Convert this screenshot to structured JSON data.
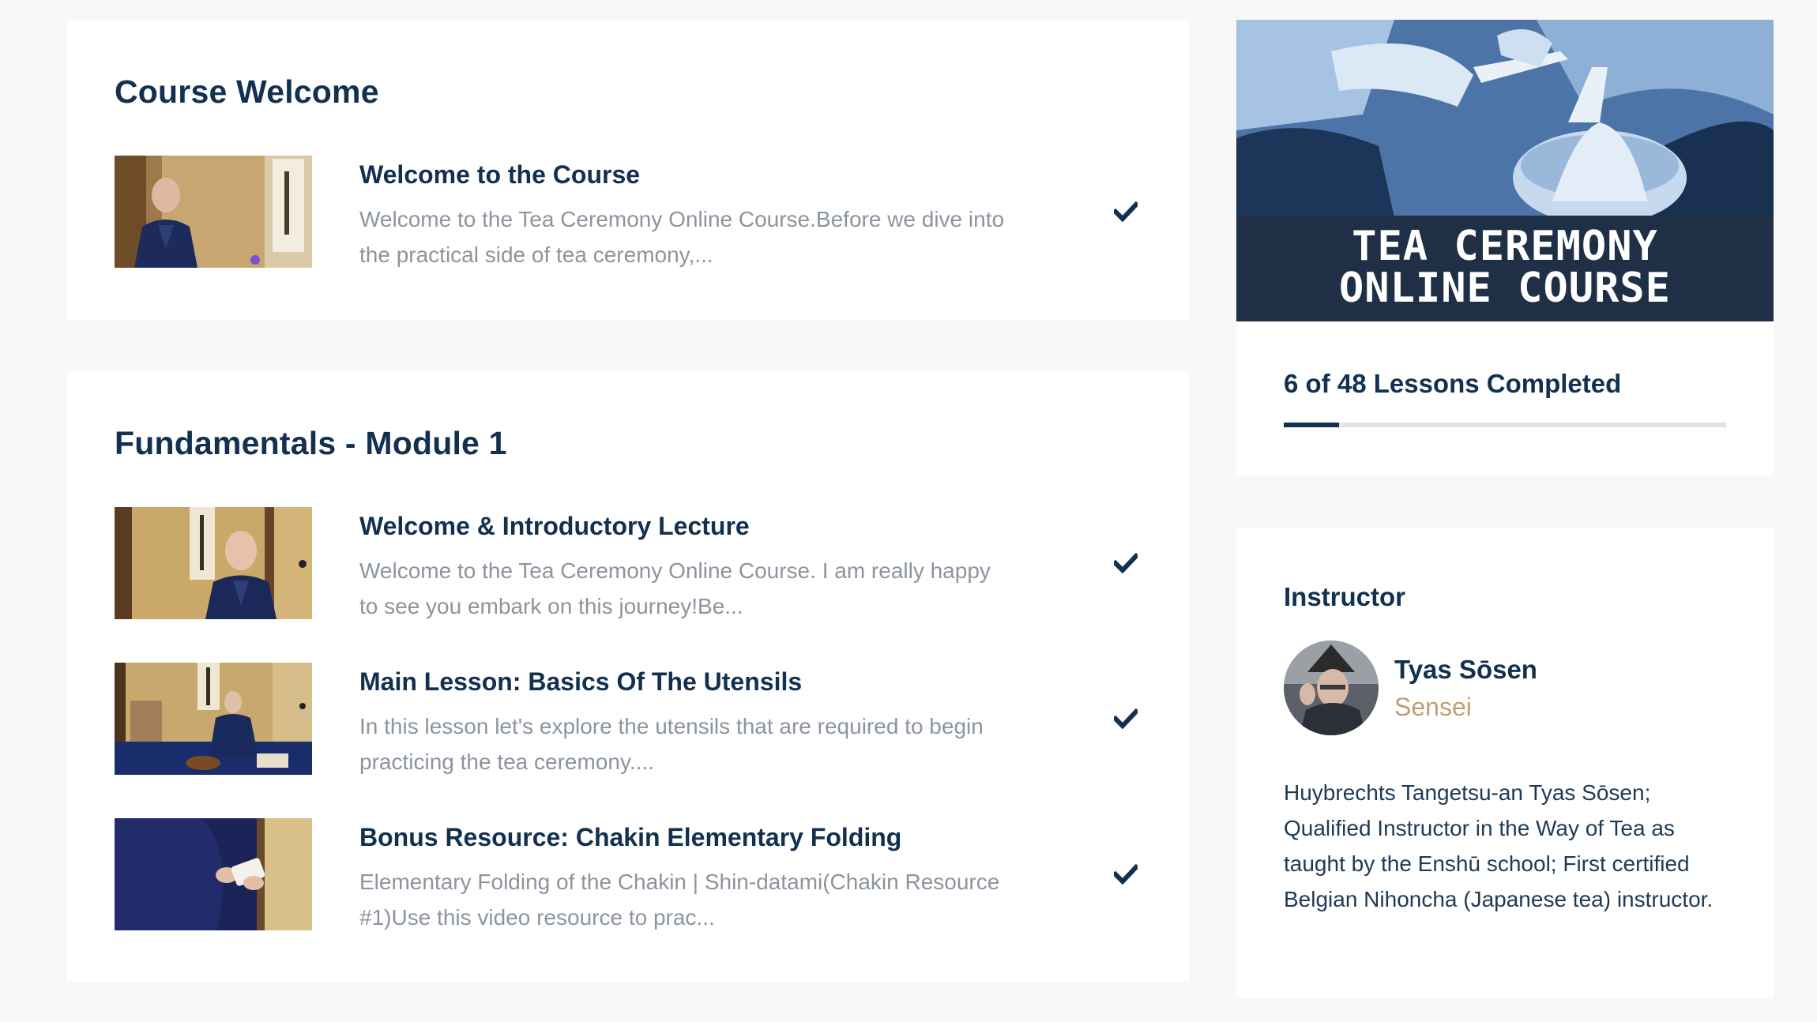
{
  "modules": [
    {
      "title": "Course Welcome",
      "lessons": [
        {
          "title": "Welcome to the Course",
          "excerpt": "Welcome to the Tea Ceremony Online Course.Before we dive into the practical side of tea ceremony,...",
          "completed": true
        }
      ]
    },
    {
      "title": "Fundamentals - Module 1",
      "lessons": [
        {
          "title": "Welcome & Introductory Lecture",
          "excerpt": "Welcome to the Tea Ceremony Online Course. I am really happy to see you embark on this journey!Be...",
          "completed": true
        },
        {
          "title": "Main Lesson: Basics Of The Utensils",
          "excerpt": "In this lesson let's explore the utensils that are required to begin practicing the tea ceremony....",
          "completed": true
        },
        {
          "title": "Bonus Resource: Chakin Elementary Folding",
          "excerpt": "Elementary Folding of the Chakin | Shin-datami(Chakin Resource #1)Use this video resource to prac...",
          "completed": true
        }
      ]
    }
  ],
  "course_banner": {
    "line1": "TEA CEREMONY",
    "line2": "ONLINE COURSE"
  },
  "progress": {
    "text": "6 of 48 Lessons Completed",
    "completed": 6,
    "total": 48
  },
  "instructor": {
    "heading": "Instructor",
    "name": "Tyas Sōsen",
    "role": "Sensei",
    "bio": "Huybrechts Tangetsu-an Tyas Sōsen; Qualified Instructor in the Way of Tea as taught by the Enshū school; First certified Belgian Nihoncha (Japanese tea) instructor."
  },
  "icons": {
    "lesson_status": "checkmark-icon"
  },
  "colors": {
    "heading": "#12304f",
    "muted_text": "#8c949e",
    "accent_gold": "#c0a070",
    "progress_fill": "#12304f",
    "progress_track": "#e1e3e6"
  }
}
